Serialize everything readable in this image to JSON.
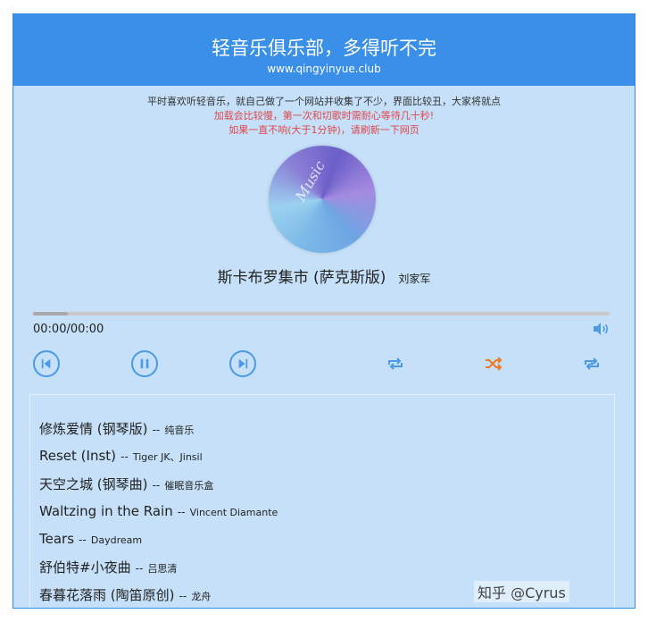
{
  "header": {
    "title": "轻音乐俱乐部，多得听不完",
    "url": "www.qingyinyue.club"
  },
  "notice": {
    "line1": "平时喜欢听轻音乐，就自己做了一个网站并收集了不少，界面比较丑，大家将就点",
    "line2": "加载会比较慢，第一次和切歌时需耐心等待几十秒!",
    "line3": "如果一直不响(大于1分钟)，请刷新一下网页"
  },
  "disc": {
    "text": "Music"
  },
  "player": {
    "song": "斯卡布罗集市 (萨克斯版)",
    "artist": "刘家军",
    "time": "00:00/00:00",
    "progress": 0.06
  },
  "controls": {
    "prev_icon": "skip-previous-icon",
    "pause_icon": "pause-icon",
    "next_icon": "skip-next-icon",
    "repeat_icon": "repeat-icon",
    "shuffle_icon": "shuffle-icon",
    "loop_one_icon": "repeat-one-icon",
    "volume_icon": "volume-icon",
    "accent": "#4a9ae6",
    "shuffle_active_color": "#f07a24"
  },
  "playlist": [
    {
      "name": "修炼爱情 (钢琴版)",
      "sep": "--",
      "artist": "纯音乐"
    },
    {
      "name": "Reset (Inst)",
      "sep": "--",
      "artist": "Tiger JK、Jinsil"
    },
    {
      "name": "天空之城 (钢琴曲)",
      "sep": "--",
      "artist": "催眠音乐盒"
    },
    {
      "name": "Waltzing in the Rain",
      "sep": "--",
      "artist": "Vincent Diamante"
    },
    {
      "name": "Tears",
      "sep": "--",
      "artist": "Daydream"
    },
    {
      "name": "舒伯特#小夜曲",
      "sep": "--",
      "artist": "吕思清"
    },
    {
      "name": "春暮花落雨 (陶笛原创)",
      "sep": "--",
      "artist": "龙舟"
    }
  ],
  "watermark": "知乎 @Cyrus"
}
